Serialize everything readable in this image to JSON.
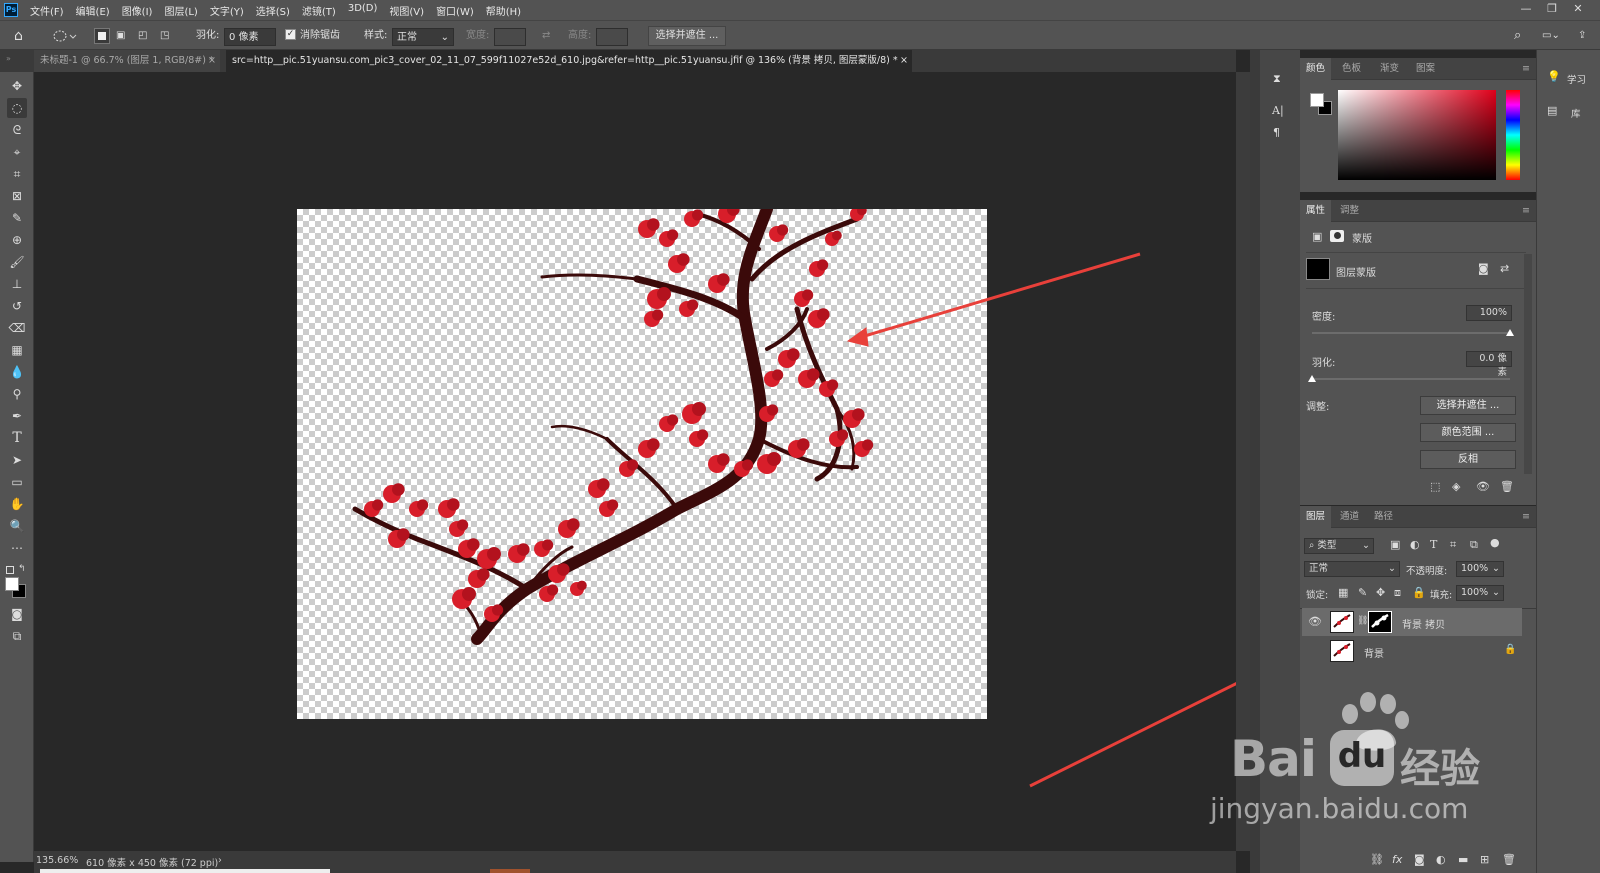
{
  "menu": [
    "文件(F)",
    "编辑(E)",
    "图像(I)",
    "图层(L)",
    "文字(Y)",
    "选择(S)",
    "滤镜(T)",
    "3D(D)",
    "视图(V)",
    "窗口(W)",
    "帮助(H)"
  ],
  "app_logo": "Ps",
  "options": {
    "feather_label": "羽化:",
    "feather_value": "0 像素",
    "antialias_label": "消除锯齿",
    "style_label": "样式:",
    "style_value": "正常",
    "width_label": "宽度:",
    "height_label": "高度:",
    "select_mask_button": "选择并遮住 ..."
  },
  "tabs": [
    {
      "title": "未标题-1 @ 66.7% (图层 1, RGB/8#) *",
      "active": false
    },
    {
      "title": "src=http__pic.51yuansu.com_pic3_cover_02_11_07_599f11027e52d_610.jpg&refer=http__pic.51yuansu.jfif @ 136% (背景 拷贝, 图层蒙版/8) *",
      "active": true
    }
  ],
  "status": {
    "zoom": "135.66%",
    "doc_info": "610 像素 x 450 像素 (72 ppi)"
  },
  "color_panel": {
    "tabs": [
      "颜色",
      "色板",
      "渐变",
      "图案"
    ]
  },
  "properties_panel": {
    "tabs": [
      "属性",
      "调整"
    ],
    "mask_label": "蒙版",
    "layer_mask_label": "图层蒙版",
    "density_label": "密度:",
    "density_value": "100%",
    "density_level": 1.0,
    "feather_label": "羽化:",
    "feather_value": "0.0 像素",
    "feather_level": 0.0,
    "adjust_label": "调整:",
    "buttons": [
      "选择并遮住 ...",
      "颜色范围 ...",
      "反相"
    ]
  },
  "layers_panel": {
    "tabs": [
      "图层",
      "通道",
      "路径"
    ],
    "filter_kind": "类型",
    "blend_mode": "正常",
    "opacity_label": "不透明度:",
    "opacity_value": "100%",
    "lock_label": "锁定:",
    "fill_label": "填充:",
    "fill_value": "100%",
    "layers": [
      {
        "name": "背景 拷贝",
        "selected": true,
        "has_mask": true,
        "locked": false
      },
      {
        "name": "背景",
        "selected": false,
        "has_mask": false,
        "locked": true
      }
    ]
  },
  "right_strip": {
    "learn_label": "学习",
    "library_label": "库"
  },
  "watermark": {
    "brand": "Bai",
    "du": "du",
    "cn": "经验",
    "url": "jingyan.baidu.com"
  },
  "colors": {
    "accent_blossom": "#d81e2a",
    "branch": "#3b0a0a",
    "annotation_arrow": "#e8403a"
  }
}
